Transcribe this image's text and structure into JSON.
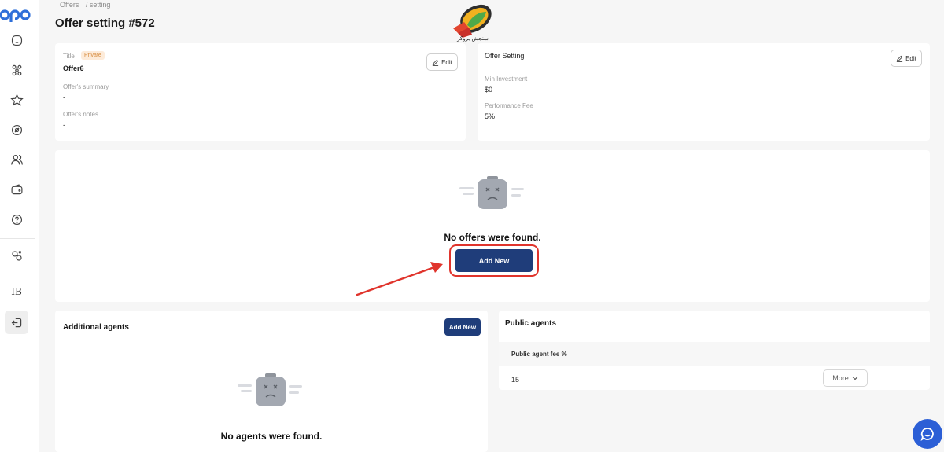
{
  "header": {
    "breadcrumb": [
      "Offers",
      "/ setting"
    ],
    "title": "Offer setting #572"
  },
  "brand_overlay": {
    "caption": "سنجش بروکر"
  },
  "offer_card": {
    "title_label": "Title",
    "visibility_badge": "Private",
    "title_value": "Offer6",
    "summary_label": "Offer's summary",
    "summary_value": "-",
    "notes_label": "Offer's notes",
    "notes_value": "-",
    "edit_label": "Edit"
  },
  "settings_card": {
    "heading": "Offer Setting",
    "min_investment_label": "Min Investment",
    "min_investment_value": "$0",
    "performance_fee_label": "Performance Fee",
    "performance_fee_value": "5%",
    "edit_label": "Edit"
  },
  "offers_panel": {
    "empty_text": "No offers were found.",
    "add_button": "Add New"
  },
  "agents_panel": {
    "title": "Additional agents",
    "add_button": "Add New",
    "empty_text": "No agents were found."
  },
  "public_agents": {
    "title": "Public agents",
    "column_header": "Public agent fee %",
    "rows": [
      {
        "fee": "15",
        "action": "More"
      }
    ]
  },
  "sidebar": {
    "items": [
      "home",
      "network",
      "star",
      "settings",
      "users",
      "wallet",
      "help",
      "integrations",
      "IB",
      "logout"
    ],
    "ib_label": "IB"
  },
  "colors": {
    "primary": "#1f3d7a",
    "highlight": "#e0342c",
    "badge_bg": "#fdebd9",
    "badge_text": "#d68a3c",
    "chat": "#2c5fd6",
    "logo": "#2f6fd9"
  }
}
